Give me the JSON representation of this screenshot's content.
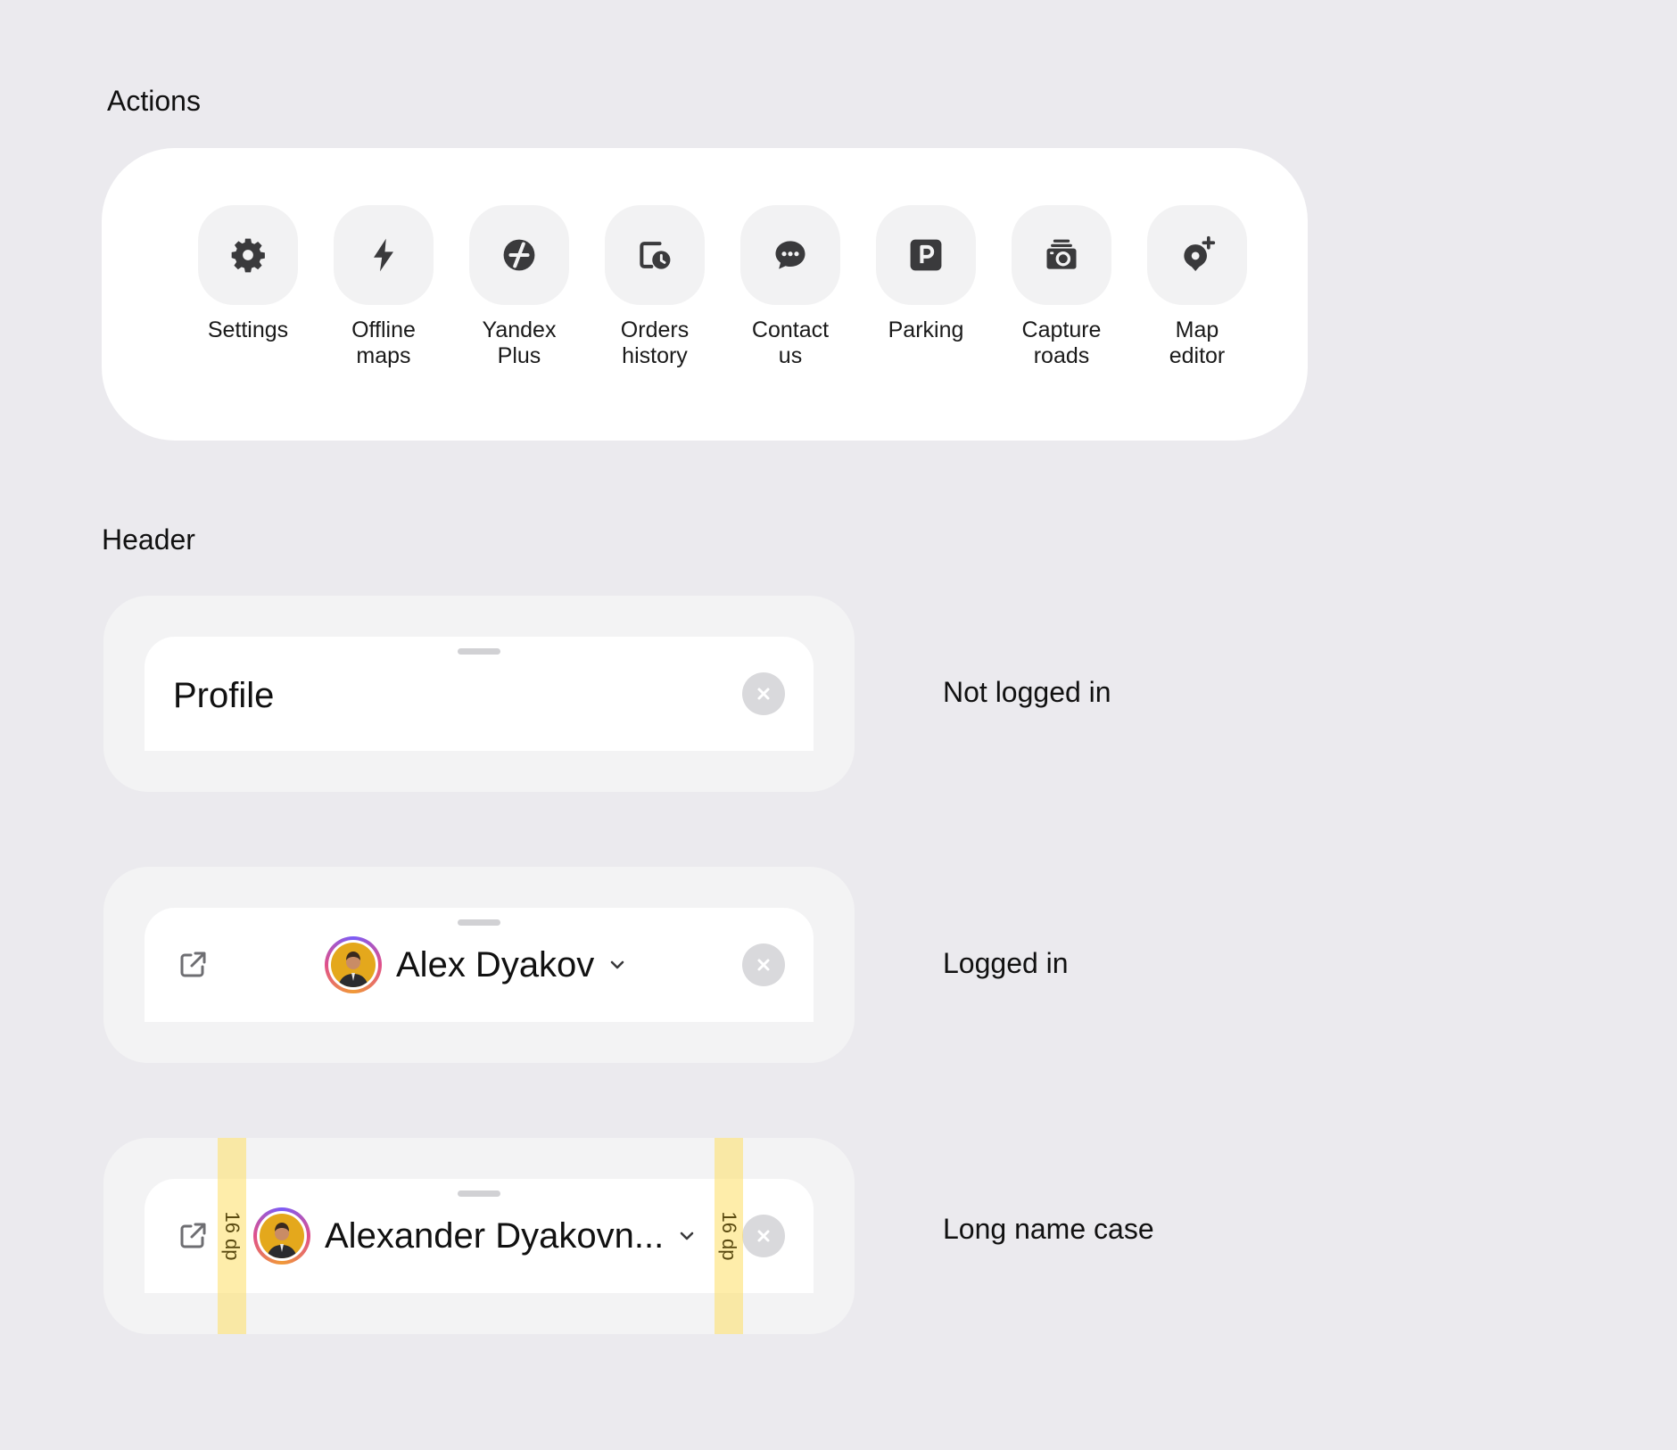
{
  "sections": {
    "actions_title": "Actions",
    "header_title": "Header"
  },
  "actions": [
    {
      "label": "Settings",
      "icon": "gear-icon"
    },
    {
      "label": "Offline\nmaps",
      "icon": "lightning-icon"
    },
    {
      "label": "Yandex\nPlus",
      "icon": "yandex-plus-icon"
    },
    {
      "label": "Orders\nhistory",
      "icon": "orders-history-icon"
    },
    {
      "label": "Contact\nus",
      "icon": "chat-bubble-icon"
    },
    {
      "label": "Parking",
      "icon": "parking-icon"
    },
    {
      "label": "Capture\nroads",
      "icon": "camera-icon"
    },
    {
      "label": "Map\neditor",
      "icon": "map-pin-plus-icon"
    }
  ],
  "headers": [
    {
      "variant": "not_logged_in",
      "title": "Profile",
      "state_label": "Not logged in"
    },
    {
      "variant": "logged_in",
      "user_name": "Alex Dyakov",
      "state_label": "Logged in"
    },
    {
      "variant": "long_name",
      "user_name": "Alexander Dyakovn...",
      "state_label": "Long name case",
      "spacing_label": "16 dp"
    }
  ],
  "colors": {
    "page_background": "#ebeaee",
    "card_background": "#ffffff",
    "icon_tile": "#f2f2f3",
    "icon_glyph": "#3a3a3c",
    "close_button": "#d9d9dc",
    "guide_highlight": "#fdde64"
  }
}
